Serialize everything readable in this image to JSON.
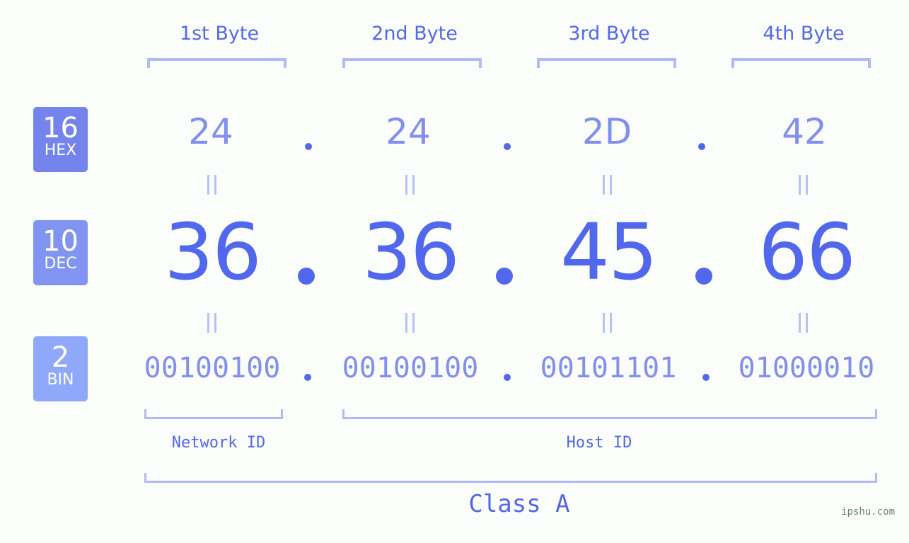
{
  "ip": {
    "dotted_decimal": "36.36.45.66",
    "separator": "."
  },
  "bases": [
    {
      "radix": "16",
      "name": "HEX",
      "color": "#7484ec"
    },
    {
      "radix": "10",
      "name": "DEC",
      "color": "#8294f2"
    },
    {
      "radix": "2",
      "name": "BIN",
      "color": "#8fa8fa"
    }
  ],
  "bytes": [
    {
      "label": "1st Byte",
      "hex": "24",
      "dec": "36",
      "bin": "00100100"
    },
    {
      "label": "2nd Byte",
      "hex": "24",
      "dec": "36",
      "bin": "00100100"
    },
    {
      "label": "3rd Byte",
      "hex": "2D",
      "dec": "45",
      "bin": "00101101"
    },
    {
      "label": "4th Byte",
      "hex": "42",
      "dec": "66",
      "bin": "01000010"
    }
  ],
  "segments": {
    "network_id": "Network ID",
    "host_id": "Host ID",
    "class": "Class A"
  },
  "colors": {
    "primary": "#5268ec",
    "light": "#8290ec",
    "bracket": "#b2baf6",
    "background": "#fbfdfb"
  },
  "watermark": "ipshu.com"
}
